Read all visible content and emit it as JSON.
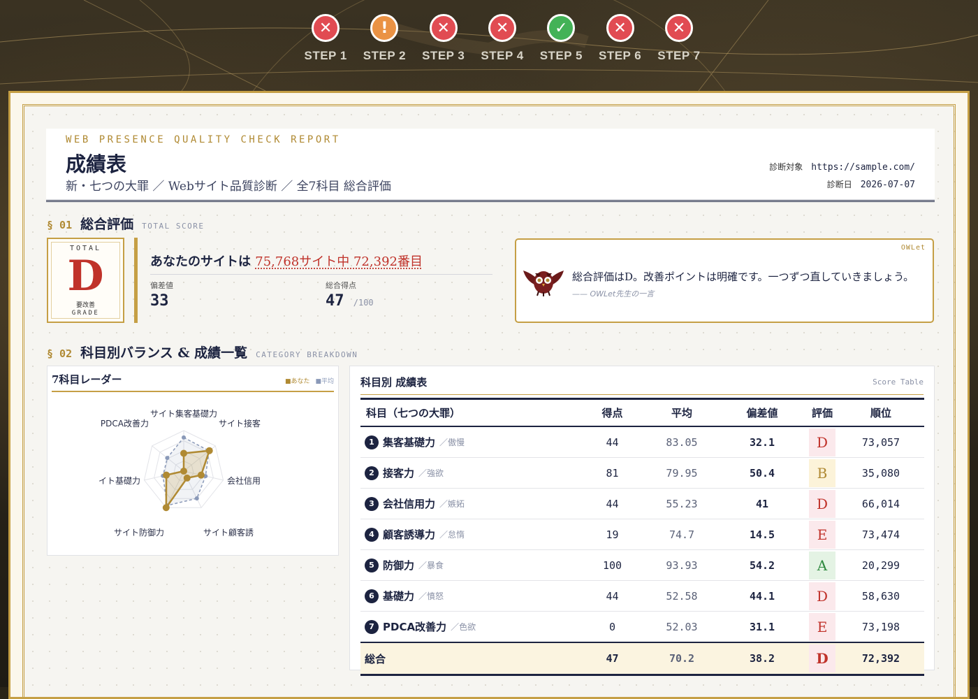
{
  "steps": [
    {
      "label": "STEP 1",
      "status": "fail",
      "icon": "x-icon"
    },
    {
      "label": "STEP 2",
      "status": "warn",
      "icon": "exclamation-icon"
    },
    {
      "label": "STEP 3",
      "status": "fail",
      "icon": "x-icon"
    },
    {
      "label": "STEP 4",
      "status": "fail",
      "icon": "x-icon"
    },
    {
      "label": "STEP 5",
      "status": "pass",
      "icon": "check-icon"
    },
    {
      "label": "STEP 6",
      "status": "fail",
      "icon": "x-icon"
    },
    {
      "label": "STEP 7",
      "status": "fail",
      "icon": "x-icon"
    }
  ],
  "header": {
    "kicker": "WEB PRESENCE QUALITY CHECK REPORT",
    "title": "成績表",
    "subtitle": "新・七つの大罪 ／ Webサイト品質診断 ／ 全7科目 総合評価",
    "target_label": "診断対象",
    "target_value": "https://sample.com/",
    "date_label": "診断日",
    "date_value": "2026-07-07"
  },
  "section1": {
    "num": "§ 01",
    "title": "総合評価",
    "en": "TOTAL SCORE"
  },
  "grade": {
    "top": "TOTAL",
    "letter": "D",
    "sub": "要改善",
    "bottom": "GRADE"
  },
  "rank": {
    "prefix": "あなたのサイトは ",
    "highlight": "75,768サイト中 72,392番目"
  },
  "stats": {
    "deviation_label": "偏差値",
    "deviation_value": "33",
    "score_label": "総合得点",
    "score_value": "47",
    "score_max": "/100"
  },
  "owl": {
    "tag": "OWLet",
    "message": "総合評価はD。改善ポイントは明確です。一つずつ直していきましょう。",
    "signature": "—— OWLet先生の一言"
  },
  "section2": {
    "num": "§ 02",
    "title": "科目別バランス & 成績一覧",
    "en": "CATEGORY BREAKDOWN"
  },
  "radar": {
    "title": "7科目レーダー",
    "legend_you": "■あなた",
    "legend_avg": "■平均",
    "labels": [
      "サイト集客基礎力",
      "サイト接客",
      "会社信用",
      "サイト顧客誘",
      "サイト防御力",
      "イト基礎力",
      "PDCA改善力"
    ],
    "you_values": [
      44,
      81,
      44,
      19,
      100,
      44,
      0
    ],
    "avg_values": [
      83.05,
      79.95,
      55.23,
      74.7,
      93.93,
      52.58,
      52.03
    ],
    "you_color": "#b08a33",
    "avg_color": "#8a99b8"
  },
  "table": {
    "title": "科目別 成績表",
    "en": "Score Table",
    "headers": {
      "name": "科目（七つの大罪）",
      "score": "得点",
      "avg": "平均",
      "dev": "偏差値",
      "grade": "評価",
      "rank": "順位"
    },
    "rows": [
      {
        "n": "1",
        "subject": "集客基礎力",
        "sin": "／傲慢",
        "score": "44",
        "avg": "83.05",
        "dev": "32.1",
        "grade": "D",
        "rank": "73,057"
      },
      {
        "n": "2",
        "subject": "接客力",
        "sin": "／強欲",
        "score": "81",
        "avg": "79.95",
        "dev": "50.4",
        "grade": "B",
        "rank": "35,080"
      },
      {
        "n": "3",
        "subject": "会社信用力",
        "sin": "／嫉妬",
        "score": "44",
        "avg": "55.23",
        "dev": "41",
        "grade": "D",
        "rank": "66,014"
      },
      {
        "n": "4",
        "subject": "顧客誘導力",
        "sin": "／怠惰",
        "score": "19",
        "avg": "74.7",
        "dev": "14.5",
        "grade": "E",
        "rank": "73,474"
      },
      {
        "n": "5",
        "subject": "防御力",
        "sin": "／暴食",
        "score": "100",
        "avg": "93.93",
        "dev": "54.2",
        "grade": "A",
        "rank": "20,299"
      },
      {
        "n": "6",
        "subject": "基礎力",
        "sin": "／憤怒",
        "score": "44",
        "avg": "52.58",
        "dev": "44.1",
        "grade": "D",
        "rank": "58,630"
      },
      {
        "n": "7",
        "subject": "PDCA改善力",
        "sin": "／色欲",
        "score": "0",
        "avg": "52.03",
        "dev": "31.1",
        "grade": "E",
        "rank": "73,198"
      }
    ],
    "total": {
      "label": "総合",
      "score": "47",
      "avg": "70.2",
      "dev": "38.2",
      "grade": "D",
      "rank": "72,392"
    }
  }
}
